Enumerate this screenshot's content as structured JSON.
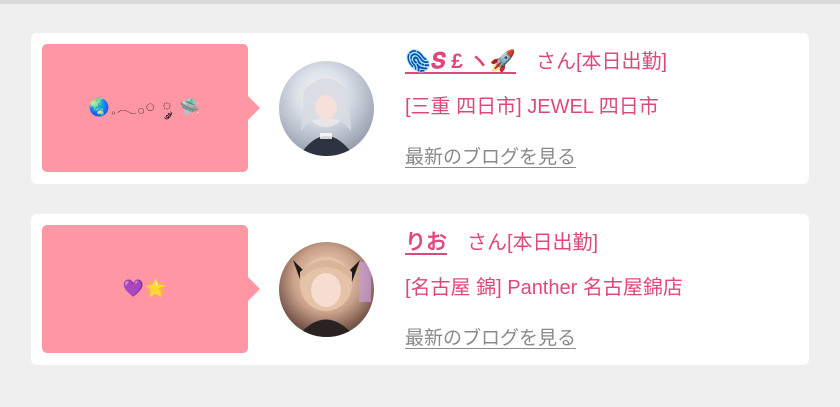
{
  "cards": [
    {
      "bubble_text": "🌏𓈒𓂃𓂂𓏸 ༘ 🛸",
      "name": "🫆𝑺 £ ヽ🚀",
      "name_suffix": "さん[本日出勤]",
      "shop": "[三重 四日市] JEWEL 四日市",
      "blog_link": "最新のブログを見る",
      "avatar_icon": "profile-photo"
    },
    {
      "bubble_text": "💜🌟",
      "name": "りお",
      "name_suffix": "さん[本日出勤]",
      "shop": "[名古屋 錦] Panther 名古屋錦店",
      "blog_link": "最新のブログを見る",
      "avatar_icon": "profile-photo"
    }
  ],
  "colors": {
    "accent": "#e0487d",
    "bubble": "#ff96a3",
    "link_gray": "#8a8a8a",
    "background": "#efefef"
  }
}
